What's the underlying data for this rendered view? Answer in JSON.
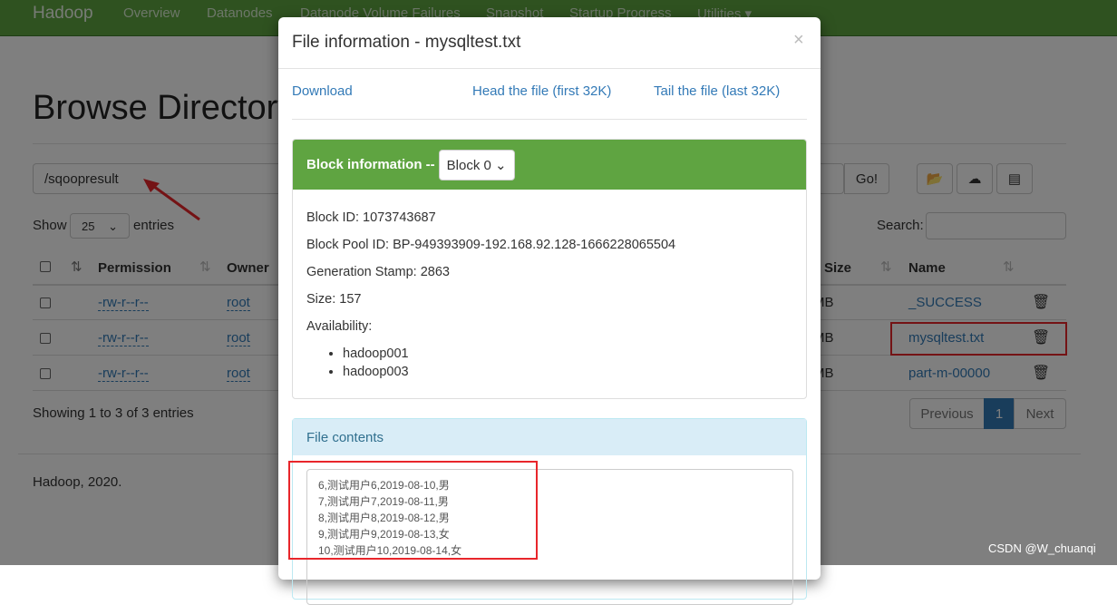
{
  "navbar": {
    "brand": "Hadoop",
    "items": [
      "Overview",
      "Datanodes",
      "Datanode Volume Failures",
      "Snapshot",
      "Startup Progress",
      "Utilities ▾"
    ]
  },
  "page": {
    "title": "Browse Directory",
    "path": "/sqoopresult",
    "go": "Go!",
    "show": "Show",
    "entries_value": "25",
    "entries": "entries",
    "search_label": "Search:",
    "showing": "Showing 1 to 3 of 3 entries",
    "previous": "Previous",
    "page_num": "1",
    "next": "Next",
    "footer": "Hadoop, 2020."
  },
  "table": {
    "headers": [
      "Permission",
      "Owner",
      "Size",
      "Name"
    ],
    "rows": [
      {
        "perm": "-rw-r--r--",
        "owner": "root",
        "size": "MB",
        "name": "_SUCCESS"
      },
      {
        "perm": "-rw-r--r--",
        "owner": "root",
        "size": "MB",
        "name": "mysqltest.txt"
      },
      {
        "perm": "-rw-r--r--",
        "owner": "root",
        "size": "MB",
        "name": "part-m-00000"
      }
    ]
  },
  "modal": {
    "title": "File information - mysqltest.txt",
    "close": "×",
    "download": "Download",
    "head": "Head the file (first 32K)",
    "tail": "Tail the file (last 32K)",
    "block_label": "Block information --",
    "block_select": "Block 0",
    "block_id": "Block ID: 1073743687",
    "pool_id": "Block Pool ID: BP-949393909-192.168.92.128-1666228065504",
    "gen_stamp": "Generation Stamp: 2863",
    "size": "Size: 157",
    "availability": "Availability:",
    "nodes": [
      "hadoop001",
      "hadoop003"
    ],
    "contents_label": "File contents",
    "contents": [
      "6,测试用户6,2019-08-10,男",
      "7,测试用户7,2019-08-11,男",
      "8,测试用户8,2019-08-12,男",
      "9,测试用户9,2019-08-13,女",
      "10,测试用户10,2019-08-14,女"
    ]
  },
  "watermark": "CSDN @W_chuanqi",
  "colors": {
    "navbar": "#5fa441",
    "link": "#337ab7",
    "annotation": "#e8262b"
  }
}
